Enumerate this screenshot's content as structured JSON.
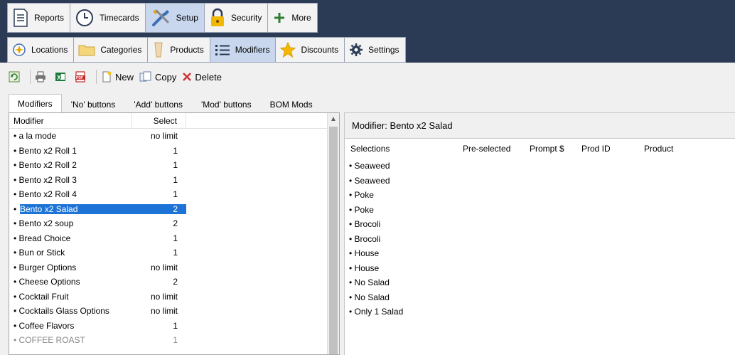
{
  "nav_row1": [
    {
      "label": "Reports",
      "icon": "document-icon"
    },
    {
      "label": "Timecards",
      "icon": "clock-icon"
    },
    {
      "label": "Setup",
      "icon": "tools-icon",
      "active": true
    },
    {
      "label": "Security",
      "icon": "lock-icon"
    },
    {
      "label": "More",
      "icon": "plus-icon"
    }
  ],
  "nav_row2": [
    {
      "label": "Locations",
      "icon": "location-icon"
    },
    {
      "label": "Categories",
      "icon": "folder-icon"
    },
    {
      "label": "Products",
      "icon": "glass-icon"
    },
    {
      "label": "Modifiers",
      "icon": "list-icon",
      "active": true
    },
    {
      "label": "Discounts",
      "icon": "star-icon"
    },
    {
      "label": "Settings",
      "icon": "gear-icon"
    }
  ],
  "toolbar": {
    "new_label": "New",
    "copy_label": "Copy",
    "delete_label": "Delete"
  },
  "tabs": [
    "Modifiers",
    "'No' buttons",
    "'Add' buttons",
    "'Mod' buttons",
    "BOM Mods"
  ],
  "left_table": {
    "col_modifier": "Modifier",
    "col_select": "Select",
    "rows": [
      {
        "name": "a la mode",
        "select": "no limit"
      },
      {
        "name": "Bento x2 Roll 1",
        "select": "1"
      },
      {
        "name": "Bento x2 Roll 2",
        "select": "1"
      },
      {
        "name": "Bento x2 Roll 3",
        "select": "1"
      },
      {
        "name": "Bento x2 Roll 4",
        "select": "1"
      },
      {
        "name": "Bento x2 Salad",
        "select": "2",
        "selected": true
      },
      {
        "name": "Bento x2 soup",
        "select": "2"
      },
      {
        "name": "Bread Choice",
        "select": "1"
      },
      {
        "name": "Bun or Stick",
        "select": "1"
      },
      {
        "name": "Burger Options",
        "select": "no limit"
      },
      {
        "name": "Cheese Options",
        "select": "2"
      },
      {
        "name": "Cocktail Fruit",
        "select": "no limit"
      },
      {
        "name": "Cocktails Glass Options",
        "select": "no limit"
      },
      {
        "name": "Coffee Flavors",
        "select": "1"
      },
      {
        "name": "COFFEE ROAST",
        "select": "1",
        "dim": true
      }
    ]
  },
  "right_panel": {
    "title": "Modifier: Bento x2 Salad",
    "col_selections": "Selections",
    "col_preselected": "Pre-selected",
    "col_prompt": "Prompt $",
    "col_prodid": "Prod ID",
    "col_product": "Product",
    "rows": [
      "Seaweed",
      "Seaweed",
      "Poke",
      "Poke",
      "Brocoli",
      "Brocoli",
      "House",
      "House",
      "No Salad",
      "No Salad",
      "Only 1 Salad"
    ]
  },
  "colors": {
    "topbar": "#2b3a55",
    "selection": "#1e74d6"
  }
}
